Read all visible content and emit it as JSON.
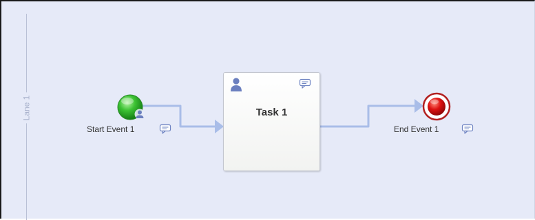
{
  "lane": {
    "label": "Lane 1"
  },
  "start_event": {
    "label": "Start Event 1",
    "color": "#2aa52a"
  },
  "task": {
    "label": "Task 1"
  },
  "end_event": {
    "label": "End Event 1",
    "color": "#cc1111"
  },
  "icons": {
    "comment": "comment-icon",
    "user": "user-icon"
  },
  "colors": {
    "canvas": "#e6eaf8",
    "flow": "#a9bde8"
  }
}
